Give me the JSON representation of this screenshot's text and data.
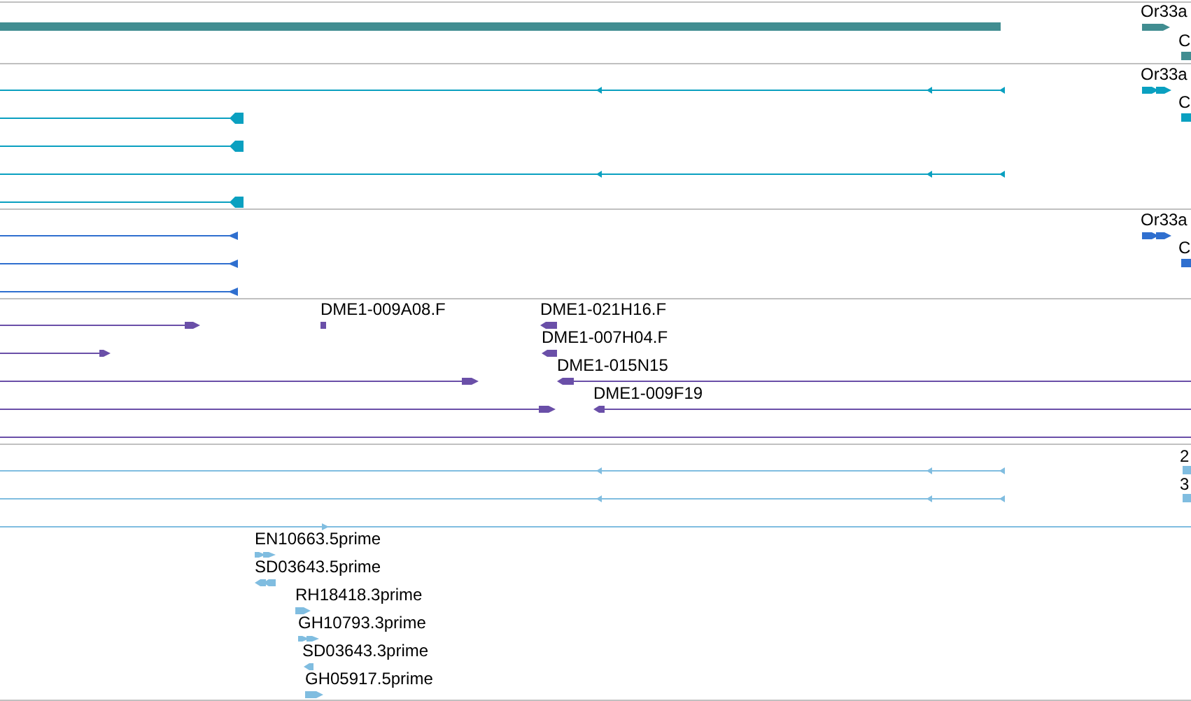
{
  "tracks": [
    {
      "color": "#418d91",
      "labels": [
        "Or33a",
        "C"
      ]
    },
    {
      "color": "#0aa0c0",
      "labels": [
        "Or33a",
        "C"
      ]
    },
    {
      "color": "#2f6fcf",
      "labels": [
        "Or33a",
        "C"
      ]
    },
    {
      "color": "#6a4fa8",
      "labels": [
        "DME1-009A08.F",
        "DME1-021H16.F",
        "DME1-007H04.F",
        "DME1-015N15",
        "DME1-009F19"
      ]
    },
    {
      "color": "#80bde0",
      "labels": [
        "2",
        "3",
        "EN10663.5prime",
        "SD03643.5prime",
        "RH18418.3prime",
        "GH10793.3prime",
        "SD03643.3prime",
        "GH05917.5prime"
      ]
    }
  ]
}
